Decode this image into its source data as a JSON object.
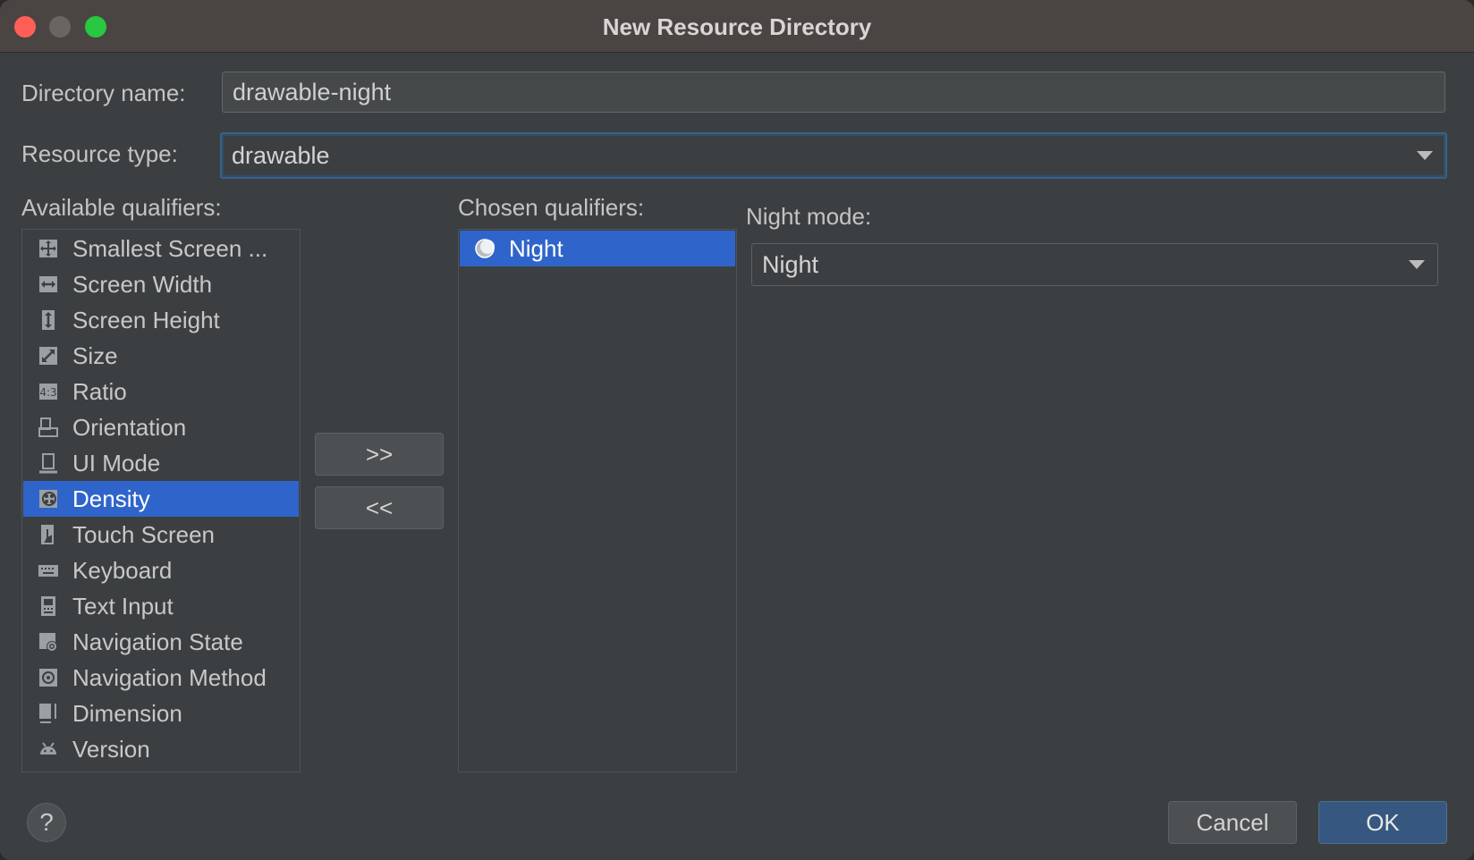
{
  "window": {
    "title": "New Resource Directory"
  },
  "form": {
    "directory_name_label": "Directory name:",
    "directory_name_value": "drawable-night",
    "resource_type_label": "Resource type:",
    "resource_type_value": "drawable"
  },
  "available": {
    "label": "Available qualifiers:",
    "items": [
      {
        "label": "Smallest Screen ...",
        "icon": "smallest-screen-icon"
      },
      {
        "label": "Screen Width",
        "icon": "screen-width-icon"
      },
      {
        "label": "Screen Height",
        "icon": "screen-height-icon"
      },
      {
        "label": "Size",
        "icon": "size-icon"
      },
      {
        "label": "Ratio",
        "icon": "ratio-icon"
      },
      {
        "label": "Orientation",
        "icon": "orientation-icon"
      },
      {
        "label": "UI Mode",
        "icon": "ui-mode-icon"
      },
      {
        "label": "Density",
        "icon": "density-icon",
        "selected": true
      },
      {
        "label": "Touch Screen",
        "icon": "touch-screen-icon"
      },
      {
        "label": "Keyboard",
        "icon": "keyboard-icon"
      },
      {
        "label": "Text Input",
        "icon": "text-input-icon"
      },
      {
        "label": "Navigation State",
        "icon": "navigation-state-icon"
      },
      {
        "label": "Navigation Method",
        "icon": "navigation-method-icon"
      },
      {
        "label": "Dimension",
        "icon": "dimension-icon"
      },
      {
        "label": "Version",
        "icon": "version-icon"
      }
    ]
  },
  "buttons": {
    "add": ">>",
    "remove": "<<",
    "cancel": "Cancel",
    "ok": "OK",
    "help": "?"
  },
  "chosen": {
    "label": "Chosen qualifiers:",
    "items": [
      {
        "label": "Night",
        "icon": "night-mode-icon",
        "selected": true
      }
    ]
  },
  "detail": {
    "label": "Night mode:",
    "value": "Night"
  },
  "colors": {
    "selection": "#2f65ca",
    "primary_button": "#365880",
    "focus_border": "#3d6185"
  }
}
